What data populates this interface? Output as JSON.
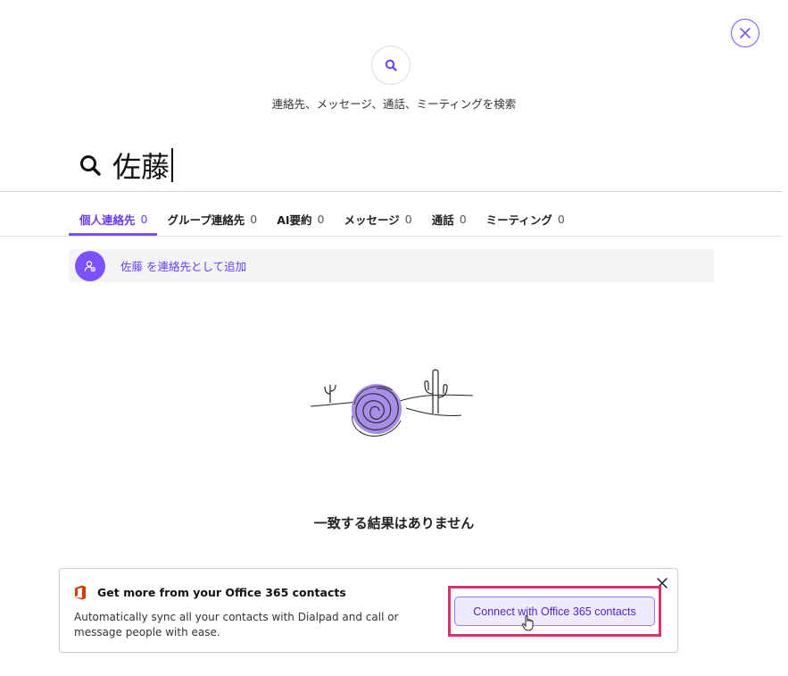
{
  "header": {
    "close_icon": "close-icon",
    "top_icon": "search-icon",
    "subtitle": "連絡先、メッセージ、通話、ミーティングを検索"
  },
  "search": {
    "value": "佐藤",
    "icon": "search-icon"
  },
  "tabs": [
    {
      "label": "個人連絡先",
      "count": "0",
      "active": true
    },
    {
      "label": "グループ連絡先",
      "count": "0",
      "active": false
    },
    {
      "label": "AI要約",
      "count": "0",
      "active": false
    },
    {
      "label": "メッセージ",
      "count": "0",
      "active": false
    },
    {
      "label": "通話",
      "count": "0",
      "active": false
    },
    {
      "label": "ミーティング",
      "count": "0",
      "active": false
    }
  ],
  "add_contact": {
    "label": "佐藤 を連絡先として追加",
    "icon": "add-person-icon"
  },
  "empty_state": {
    "message": "一致する結果はありません",
    "illustration": "desert-cactus-illustration"
  },
  "banner": {
    "logo": "office-logo-icon",
    "title": "Get more from your Office 365 contacts",
    "description": "Automatically sync all your contacts with Dialpad and call or message people with ease.",
    "button_label": "Connect with Office 365 contacts",
    "close_icon": "close-icon"
  },
  "colors": {
    "accent": "#7c52ff",
    "accent_text": "#6a3df0",
    "highlight": "#d6336c",
    "office_red": "#d83b01"
  }
}
